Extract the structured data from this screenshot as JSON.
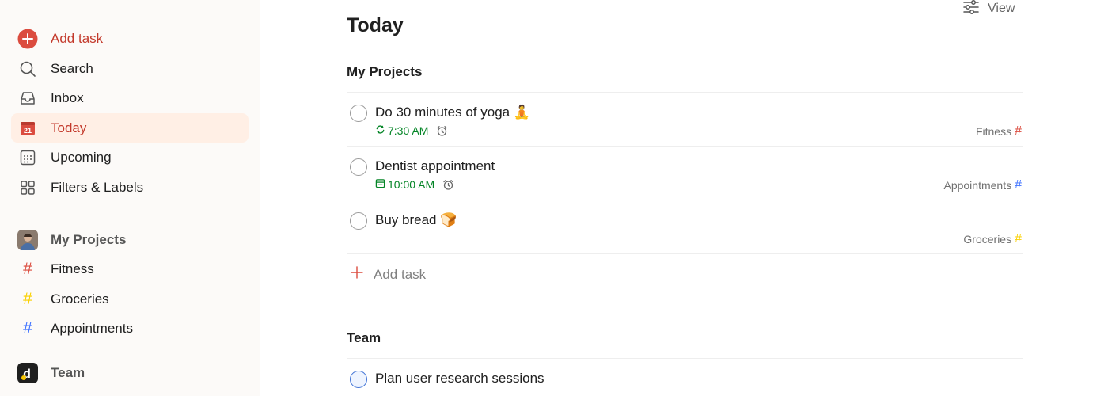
{
  "sidebar": {
    "add_task": "Add task",
    "search": "Search",
    "inbox": "Inbox",
    "today": "Today",
    "today_date": "21",
    "upcoming": "Upcoming",
    "filters": "Filters & Labels",
    "my_projects": "My Projects",
    "projects": [
      {
        "label": "Fitness",
        "color": "#db4c3f"
      },
      {
        "label": "Groceries",
        "color": "#fad000"
      },
      {
        "label": "Appointments",
        "color": "#4073ff"
      }
    ],
    "team": "Team"
  },
  "main": {
    "view_label": "View",
    "title": "Today",
    "my_projects_section": "My Projects",
    "tasks": [
      {
        "title": "Do 30 minutes of yoga 🧘",
        "time": "7:30 AM",
        "time_icon": "recurring-icon",
        "project": "Fitness",
        "project_color": "#db4c3f"
      },
      {
        "title": "Dentist appointment",
        "time": "10:00 AM",
        "time_icon": "calendar-icon",
        "project": "Appointments",
        "project_color": "#4073ff"
      },
      {
        "title": "Buy bread 🍞",
        "project": "Groceries",
        "project_color": "#fad000"
      }
    ],
    "add_task_label": "Add task",
    "team_section": "Team",
    "team_tasks": [
      {
        "title": "Plan user research sessions"
      }
    ]
  },
  "colors": {
    "accent": "#db4c3f",
    "today_bg": "#ffefe5",
    "time_green": "#058527",
    "sidebar_bg": "#fcfaf8"
  }
}
